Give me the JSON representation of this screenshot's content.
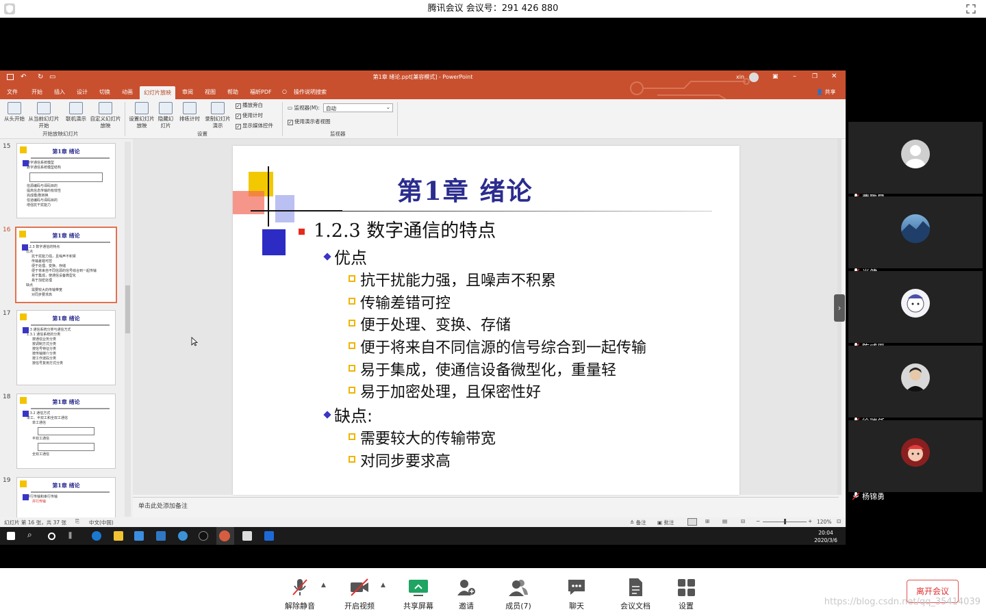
{
  "meeting": {
    "title": "腾讯会议 会议号：291 426 880"
  },
  "ppt": {
    "window_title": "第1章 绪论.ppt[兼容模式] - PowerPoint",
    "user": "xin",
    "share": "共享",
    "tabs": [
      "文件",
      "开始",
      "插入",
      "设计",
      "切换",
      "动画",
      "幻灯片放映",
      "审阅",
      "视图",
      "帮助",
      "福昕PDF",
      "操作说明搜索"
    ],
    "active_tab": "幻灯片放映",
    "ribbon": {
      "from_start": "从头开始",
      "from_current": "从当前幻灯片开始",
      "online": "联机演示",
      "custom": "自定义幻灯片放映",
      "group_start": "开始放映幻灯片",
      "setup": "设置幻灯片放映",
      "hide": "隐藏幻灯片",
      "rehearse": "排练计时",
      "record": "录制幻灯片演示",
      "chk_narration": "播放旁白",
      "chk_timing": "使用计时",
      "chk_media": "显示媒体控件",
      "group_setup": "设置",
      "monitor_label": "监视器(M):",
      "monitor_value": "自动",
      "presenter_view": "使用演示者视图",
      "group_monitor": "监视器"
    },
    "thumbnails": [
      {
        "num": "15",
        "title": "第1章 绪论",
        "lines": [
          "数字通信系统模型",
          "数字通信系统模型结构",
          "信源编码与译码目的",
          "提高信息传输的有效性",
          "完成模/数转换",
          "信道编码与译码目的",
          "增强抗干扰能力"
        ]
      },
      {
        "num": "16",
        "title": "第1章 绪论",
        "lines": [
          "1.2.3 数字通信的特点",
          "优点",
          "抗干扰能力强，且噪声不积累",
          "传输差错可控",
          "便于处理、变换、存储",
          "便于将来自不同信源的信号综合到一起传输",
          "易于集成，使通信设备微型化",
          "易于加密处理",
          "缺点",
          "需要较大的传输带宽",
          "对同步要求高"
        ]
      },
      {
        "num": "17",
        "title": "第1章 绪论",
        "lines": [
          "1.3 通信系统分类与通信方式",
          "1.3.1 通信系统的分类",
          "按通信业务分类",
          "按调制方式分类",
          "按信号特征分类",
          "按传输媒介分类",
          "按工作波段分类",
          "按信号复用方式分类"
        ]
      },
      {
        "num": "18",
        "title": "第1章 绪论",
        "lines": [
          "1.3.2 通信方式",
          "单工、半双工和全双工通信",
          "单工通信",
          "半双工通信",
          "全双工通信"
        ]
      },
      {
        "num": "19",
        "title": "第1章 绪论",
        "lines": [
          "并行传输和串行传输",
          "并行传输"
        ]
      }
    ],
    "slide": {
      "title": "第1章 绪论",
      "heading": "1.2.3  数字通信的特点",
      "pros_label": "优点",
      "pros": [
        "抗干扰能力强，且噪声不积累",
        "传输差错可控",
        "便于处理、变换、存储",
        "便于将来自不同信源的信号综合到一起传输",
        "易于集成，使通信设备微型化，重量轻",
        "易于加密处理，且保密性好"
      ],
      "cons_label": "缺点:",
      "cons": [
        "需要较大的传输带宽",
        "对同步要求高"
      ]
    },
    "notes_placeholder": "单击此处添加备注",
    "status": {
      "slide_info": "幻灯片 第 16 张，共 37 张",
      "language": "中文(中国)",
      "notes": "备注",
      "comments": "批注",
      "zoom": "120%"
    },
    "clock": {
      "time": "20:04",
      "date": "2020/3/6"
    }
  },
  "participants": [
    {
      "name": "曹鹏晨",
      "avatar": "gray"
    },
    {
      "name": "肖健",
      "avatar": "landscape"
    },
    {
      "name": "陈威平",
      "avatar": "cartoon"
    },
    {
      "name": "徐瑞任",
      "avatar": "photo"
    },
    {
      "name": "杨锦勇",
      "avatar": "red-cartoon"
    }
  ],
  "toolbar": {
    "unmute": "解除静音",
    "video": "开启视频",
    "share": "共享屏幕",
    "invite": "邀请",
    "members": "成员(7)",
    "chat": "聊天",
    "docs": "会议文档",
    "settings": "设置",
    "leave": "离开会议"
  },
  "watermark": "https://blog.csdn.net/qq_35414039"
}
